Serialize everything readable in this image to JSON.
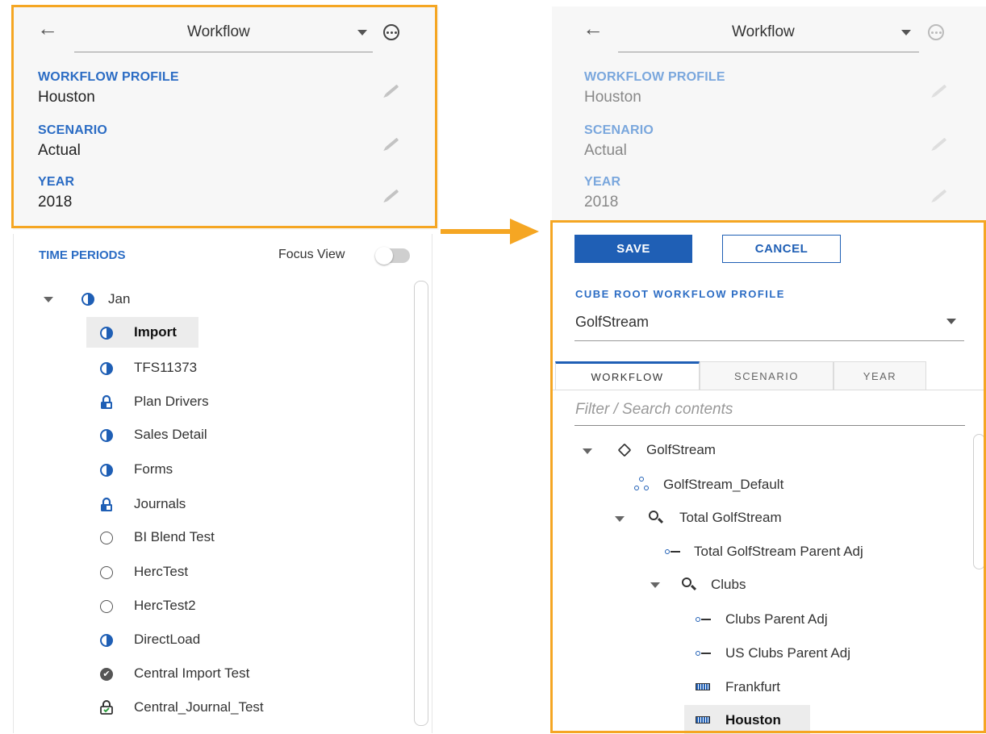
{
  "left_panel": {
    "header": {
      "title": "Workflow",
      "props": [
        {
          "label": "WORKFLOW PROFILE",
          "value": "Houston"
        },
        {
          "label": "SCENARIO",
          "value": "Actual"
        },
        {
          "label": "YEAR",
          "value": "2018"
        }
      ]
    },
    "time_periods": {
      "title": "TIME PERIODS",
      "focus_view_label": "Focus View",
      "focus_view_on": false,
      "root": {
        "label": "Jan",
        "icon": "half-circle-icon",
        "expanded": true
      },
      "items": [
        {
          "label": "Import",
          "icon": "half-circle-icon",
          "selected": true
        },
        {
          "label": "TFS11373",
          "icon": "half-circle-icon"
        },
        {
          "label": "Plan Drivers",
          "icon": "lock-icon"
        },
        {
          "label": "Sales Detail",
          "icon": "half-circle-icon"
        },
        {
          "label": "Forms",
          "icon": "half-circle-icon"
        },
        {
          "label": "Journals",
          "icon": "lock-icon"
        },
        {
          "label": "BI Blend Test",
          "icon": "empty-circle-icon"
        },
        {
          "label": "HercTest",
          "icon": "empty-circle-icon"
        },
        {
          "label": "HercTest2",
          "icon": "empty-circle-icon"
        },
        {
          "label": "DirectLoad",
          "icon": "half-circle-icon"
        },
        {
          "label": "Central Import Test",
          "icon": "check-circle-icon"
        },
        {
          "label": "Central_Journal_Test",
          "icon": "lock-check-icon"
        }
      ]
    }
  },
  "right_panel": {
    "header": {
      "title": "Workflow",
      "props": [
        {
          "label": "WORKFLOW PROFILE",
          "value": "Houston"
        },
        {
          "label": "SCENARIO",
          "value": "Actual"
        },
        {
          "label": "YEAR",
          "value": "2018"
        }
      ]
    },
    "buttons": {
      "save": "SAVE",
      "cancel": "CANCEL"
    },
    "cube_root": {
      "label": "CUBE ROOT WORKFLOW PROFILE",
      "value": "GolfStream"
    },
    "tabs": [
      {
        "label": "WORKFLOW",
        "active": true
      },
      {
        "label": "SCENARIO"
      },
      {
        "label": "YEAR"
      }
    ],
    "filter_placeholder": "Filter / Search contents",
    "tree": [
      {
        "label": "GolfStream",
        "icon": "cube-icon",
        "expanded": true
      },
      {
        "label": "GolfStream_Default",
        "icon": "network-icon"
      },
      {
        "label": "Total GolfStream",
        "icon": "search-icon",
        "expanded": true
      },
      {
        "label": "Total GolfStream Parent Adj",
        "icon": "adj-icon"
      },
      {
        "label": "Clubs",
        "icon": "search-icon",
        "expanded": true
      },
      {
        "label": "Clubs Parent Adj",
        "icon": "adj-icon"
      },
      {
        "label": "US Clubs Parent Adj",
        "icon": "adj-icon"
      },
      {
        "label": "Frankfurt",
        "icon": "battery-icon"
      },
      {
        "label": "Houston",
        "icon": "battery-icon",
        "selected": true
      }
    ]
  },
  "colors": {
    "highlight": "#f5a623",
    "accent": "#1f5fb5",
    "label_blue": "#2b6cc4"
  }
}
